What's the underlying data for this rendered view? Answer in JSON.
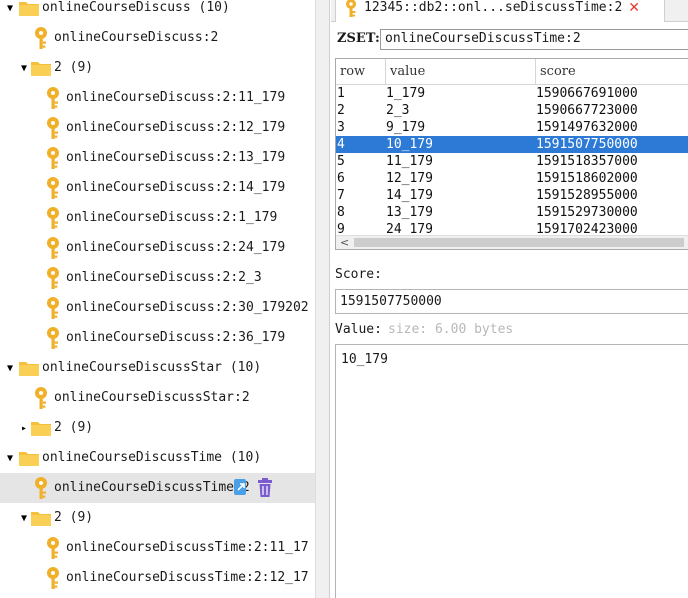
{
  "tree": {
    "nodes": [
      {
        "kind": "folder",
        "label": "onlineCourseDiscuss (10)",
        "expander": "▼"
      },
      {
        "kind": "key",
        "label": "onlineCourseDiscuss:2"
      },
      {
        "kind": "folder",
        "label": "2 (9)",
        "expander": "▼"
      },
      {
        "kind": "key",
        "label": "onlineCourseDiscuss:2:11_179"
      },
      {
        "kind": "key",
        "label": "onlineCourseDiscuss:2:12_179"
      },
      {
        "kind": "key",
        "label": "onlineCourseDiscuss:2:13_179"
      },
      {
        "kind": "key",
        "label": "onlineCourseDiscuss:2:14_179"
      },
      {
        "kind": "key",
        "label": "onlineCourseDiscuss:2:1_179"
      },
      {
        "kind": "key",
        "label": "onlineCourseDiscuss:2:24_179"
      },
      {
        "kind": "key",
        "label": "onlineCourseDiscuss:2:2_3"
      },
      {
        "kind": "key",
        "label": "onlineCourseDiscuss:2:30_179202"
      },
      {
        "kind": "key",
        "label": "onlineCourseDiscuss:2:36_179"
      },
      {
        "kind": "folder",
        "label": "onlineCourseDiscussStar (10)",
        "expander": "▼"
      },
      {
        "kind": "key",
        "label": "onlineCourseDiscussStar:2"
      },
      {
        "kind": "folder",
        "label": "2 (9)",
        "expander": "▸"
      },
      {
        "kind": "folder",
        "label": "onlineCourseDiscussTime (10)",
        "expander": "▼"
      },
      {
        "kind": "key",
        "label": "onlineCourseDiscussTime:2",
        "selected": true
      },
      {
        "kind": "folder",
        "label": "2 (9)",
        "expander": "▼"
      },
      {
        "kind": "key",
        "label": "onlineCourseDiscussTime:2:11_17"
      },
      {
        "kind": "key",
        "label": "onlineCourseDiscussTime:2:12_17"
      }
    ]
  },
  "tab": {
    "title": "12345::db2::onl...seDiscussTime:2",
    "close": "✕"
  },
  "zset": {
    "label": "ZSET:",
    "key_name": "onlineCourseDiscussTime:2"
  },
  "grid": {
    "columns": [
      "row",
      "value",
      "score"
    ],
    "sort_mark": "^",
    "selected_row": 4,
    "rows": [
      {
        "row": "1",
        "value": "1_179",
        "score": "1590667691000"
      },
      {
        "row": "2",
        "value": "2_3",
        "score": "1590667723000"
      },
      {
        "row": "3",
        "value": "9_179",
        "score": "1591497632000"
      },
      {
        "row": "4",
        "value": "10_179",
        "score": "1591507750000"
      },
      {
        "row": "5",
        "value": "11_179",
        "score": "1591518357000"
      },
      {
        "row": "6",
        "value": "12_179",
        "score": "1591518602000"
      },
      {
        "row": "7",
        "value": "14_179",
        "score": "1591528955000"
      },
      {
        "row": "8",
        "value": "13_179",
        "score": "1591529730000"
      },
      {
        "row": "9",
        "value": "24_179",
        "score": "1591702423000"
      }
    ],
    "scroll_left_arrow": "<"
  },
  "editor": {
    "score_label": "Score:",
    "score_value": "1591507750000",
    "value_label": "Value:",
    "value_size": "size: 6.00 bytes",
    "value_text": "10_179"
  },
  "colors": {
    "folder": "#f5c03a",
    "key": "#f0b02a",
    "selection": "#2c7ad6",
    "tree_selection": "#e5e5e5",
    "delete": "#7b5ccf",
    "copy": "#4aa0e6"
  },
  "icons": {
    "folder": "folder-icon",
    "key": "key-icon",
    "copy": "copy-icon",
    "delete": "delete-icon",
    "close": "close-icon"
  }
}
